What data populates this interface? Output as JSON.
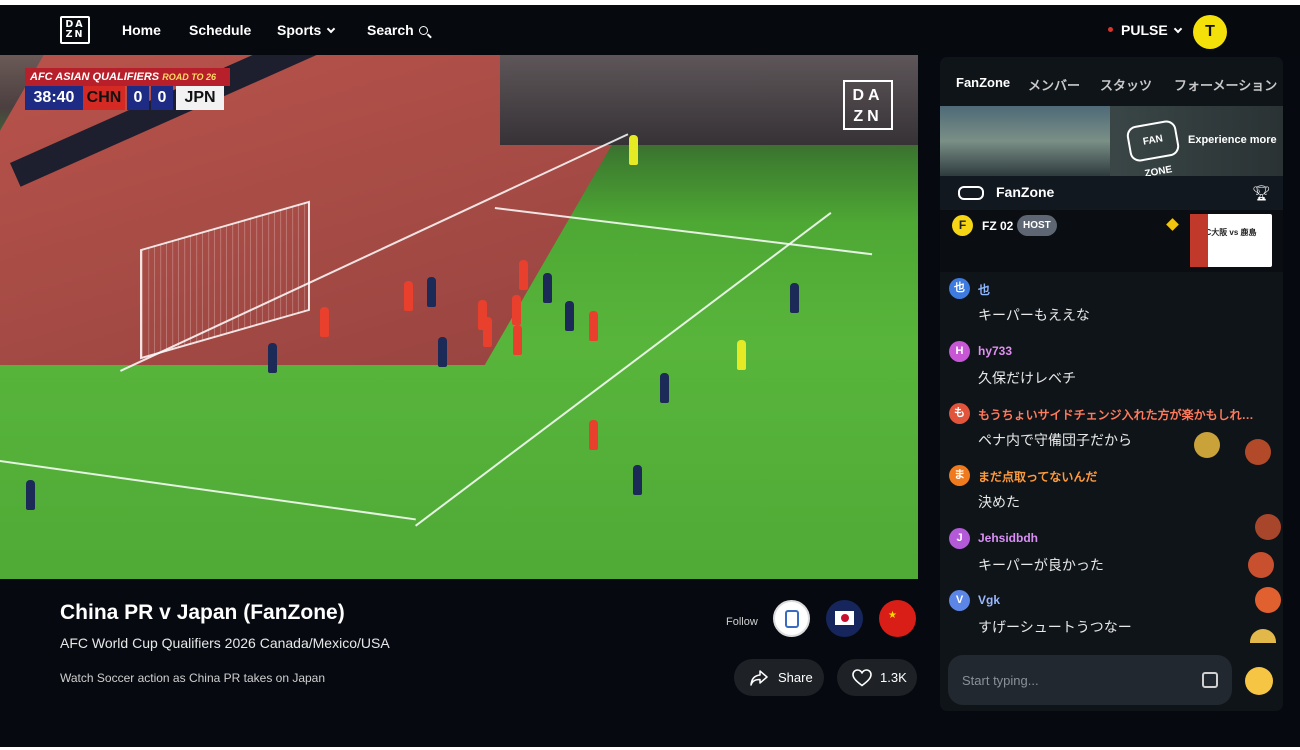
{
  "nav": {
    "logo": "DA ZN",
    "home": "Home",
    "schedule": "Schedule",
    "sports": "Sports",
    "search": "Search",
    "pulse": "PULSE",
    "avatar_initial": "T"
  },
  "scoreboard": {
    "competition": "AFC ASIAN QUALIFIERS",
    "road": "ROAD TO 26",
    "clock": "38:40",
    "home_team": "CHN",
    "home_score": "0",
    "away_score": "0",
    "away_team": "JPN",
    "watermark": "DA ZN"
  },
  "event": {
    "title": "China PR v Japan (FanZone)",
    "subtitle": "AFC World Cup Qualifiers 2026 Canada/Mexico/USA",
    "description": "Watch Soccer action as China PR takes on Japan",
    "follow_label": "Follow",
    "share_label": "Share",
    "likes": "1.3K"
  },
  "chat": {
    "tabs": [
      "FanZone",
      "メンバー",
      "スタッツ",
      "フォーメーション"
    ],
    "promo_text": "Experience more",
    "promo_logo": "FAN ZONE",
    "header_label": "FanZone",
    "pinned": {
      "initial": "F",
      "name": "FZ 02",
      "badge": "HOST",
      "thumb_text": "C大阪 vs 鹿島"
    },
    "messages": [
      {
        "initial": "也",
        "name": "也",
        "text": "キーパーもええな",
        "avatar_color": "#3d7be0",
        "name_color": "#8fb8ff"
      },
      {
        "initial": "H",
        "name": "hy733",
        "text": "久保だけレベチ",
        "avatar_color": "#c857d6",
        "name_color": "#e08ff0"
      },
      {
        "initial": "も",
        "name": "もうちょいサイドチェンジ入れた方が楽かもしれ…",
        "text": "ペナ内で守備団子だから",
        "avatar_color": "#e0553b",
        "name_color": "#ff7a5c"
      },
      {
        "initial": "ま",
        "name": "まだ点取ってないんだ",
        "text": "決めた",
        "avatar_color": "#f07a1e",
        "name_color": "#ff9a3c"
      },
      {
        "initial": "J",
        "name": "Jehsidbdh",
        "text": "キーパーが良かった",
        "avatar_color": "#b45ad9",
        "name_color": "#d98ff5"
      },
      {
        "initial": "V",
        "name": "Vgk",
        "text": "すげーシュートうつなー",
        "avatar_color": "#5b86e8",
        "name_color": "#9bb8ff"
      }
    ],
    "input_placeholder": "Start typing..."
  }
}
